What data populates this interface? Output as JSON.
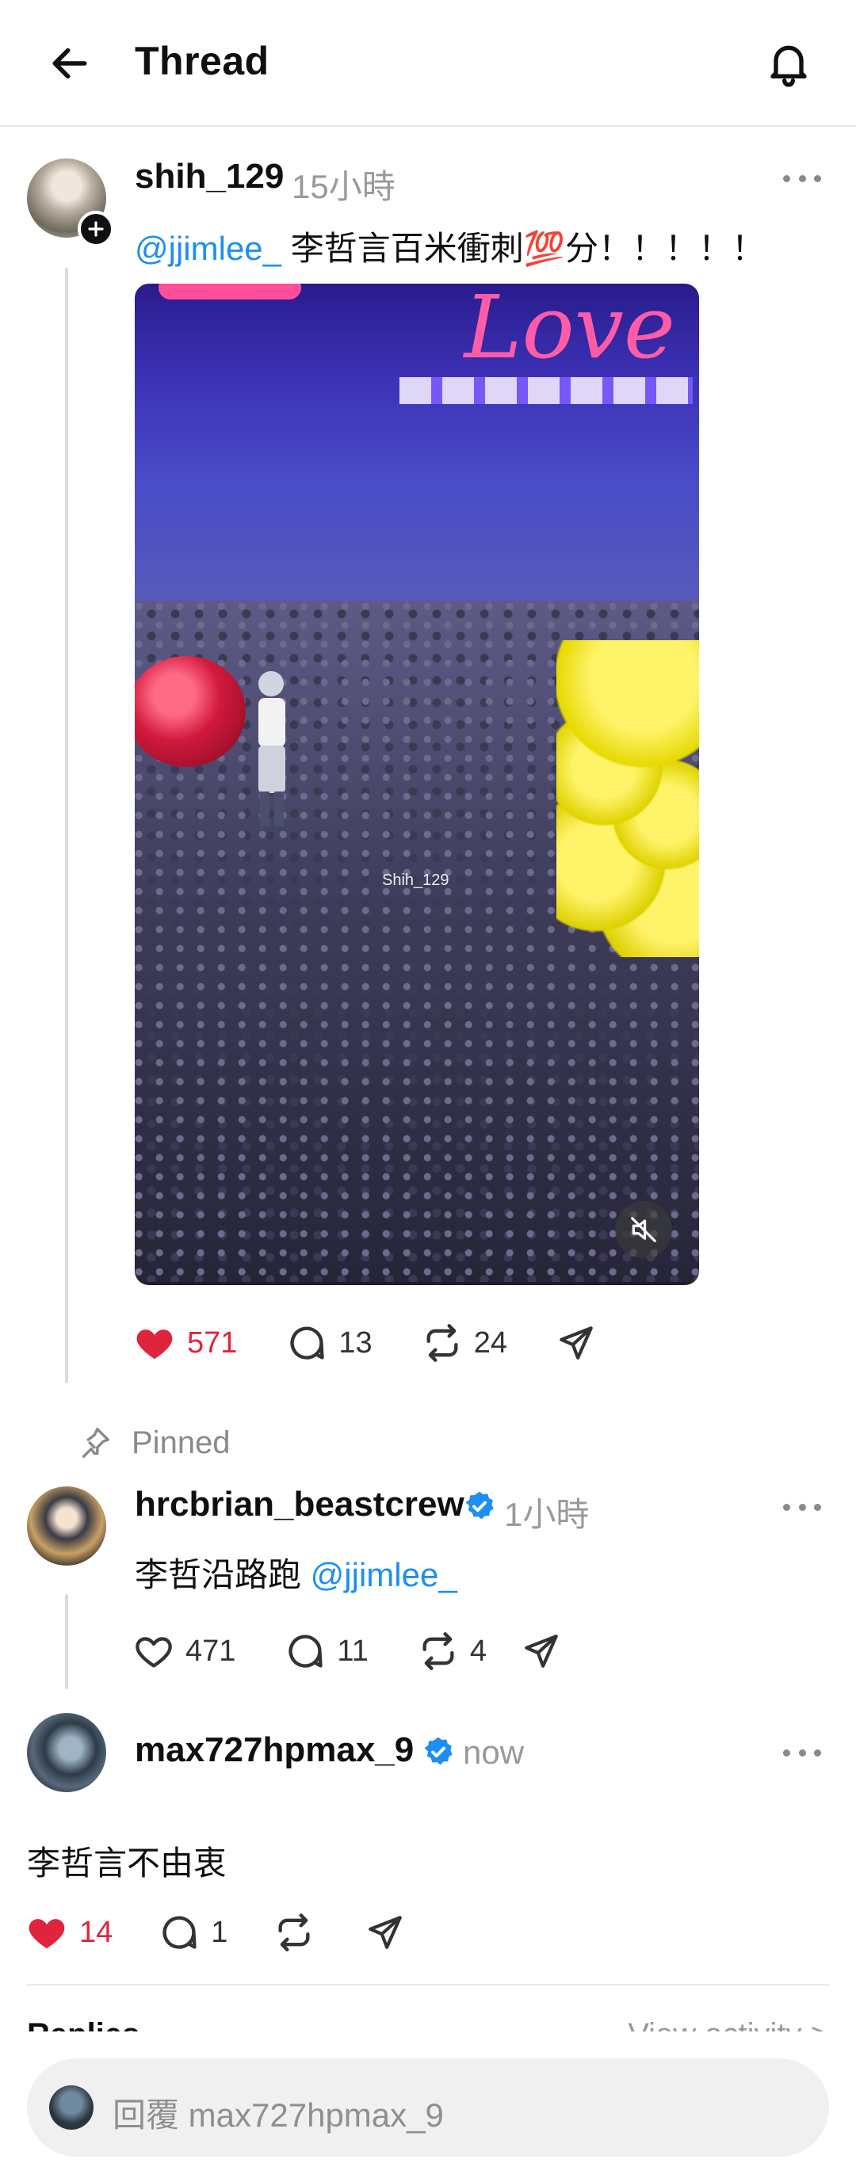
{
  "header": {
    "title": "Thread",
    "back_icon": "arrow-left-icon",
    "notifications_icon": "bell-icon"
  },
  "main_post": {
    "username": "shih_129",
    "time": "15小時",
    "mention": "@jjimlee_",
    "text": " 李哲言百米衝刺💯分！！！！！",
    "video": {
      "watermark": "Shih_129",
      "love_sign": "Love",
      "mute_icon": "speaker-muted-icon"
    },
    "likes": "571",
    "comments": "13",
    "reposts": "24",
    "liked": true
  },
  "pinned_label": "Pinned",
  "pinned_reply": {
    "username": "hrcbrian_beastcrew",
    "verified": true,
    "time": "1小時",
    "text": "李哲沿路跑 ",
    "mention": "@jjimlee_",
    "likes": "471",
    "comments": "11",
    "reposts": "4"
  },
  "own_reply": {
    "username": "max727hpmax_9",
    "verified": true,
    "time": "now",
    "text": "李哲言不由衷",
    "likes": "14",
    "comments": "1",
    "liked": true
  },
  "replies_section": {
    "label": "Replies",
    "view_activity": "View activity >"
  },
  "reply_input": {
    "placeholder": "回覆 max727hpmax_9"
  },
  "colors": {
    "like_red": "#e0243c",
    "mention_blue": "#1d8ff0",
    "verified_blue": "#1d8ff0"
  }
}
